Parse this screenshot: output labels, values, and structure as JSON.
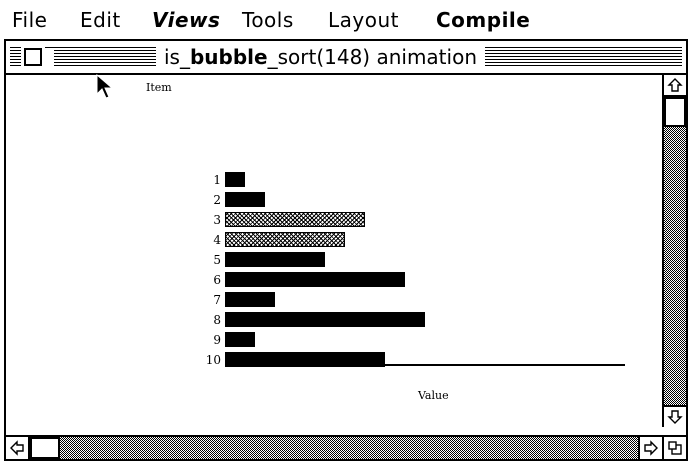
{
  "menubar": {
    "items": [
      {
        "label": "File",
        "style": "plain"
      },
      {
        "label": "Edit",
        "style": "plain"
      },
      {
        "label": "Views",
        "style": "bold-italic"
      },
      {
        "label": "Tools",
        "style": "plain"
      },
      {
        "label": "Layout",
        "style": "plain"
      },
      {
        "label": "Compile",
        "style": "bold"
      }
    ]
  },
  "window": {
    "title_prefix": "is_",
    "title_bold": "bubble",
    "title_suffix": "_sort(148) animation"
  },
  "chart": {
    "y_axis_label": "Item",
    "x_axis_label": "Value"
  },
  "chart_data": {
    "type": "bar",
    "orientation": "horizontal",
    "categories": [
      "1",
      "2",
      "3",
      "4",
      "5",
      "6",
      "7",
      "8",
      "9",
      "10"
    ],
    "values": [
      2,
      4,
      14,
      12,
      10,
      18,
      5,
      20,
      3,
      16
    ],
    "highlighted": [
      3,
      4
    ],
    "xlabel": "Value",
    "ylabel": "Item",
    "xlim": [
      0,
      40
    ],
    "grid": false
  },
  "icons": {
    "close": "close-box-icon",
    "zoom": "zoom-box-icon",
    "scroll_up": "arrow-up-icon",
    "scroll_down": "arrow-down-icon",
    "scroll_left": "arrow-left-icon",
    "scroll_right": "arrow-right-icon",
    "size": "size-box-icon",
    "cursor": "pointer-cursor-icon"
  },
  "colors": {
    "foreground": "#000000",
    "background": "#ffffff"
  }
}
